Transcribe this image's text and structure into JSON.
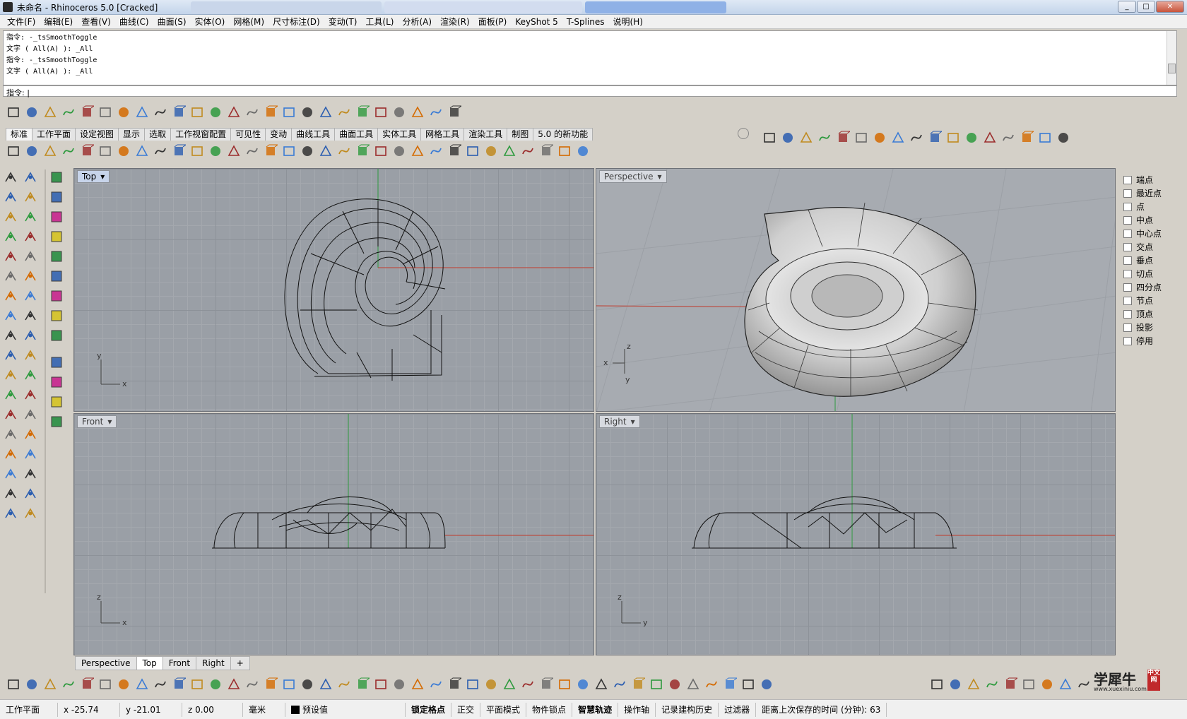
{
  "window": {
    "title": "未命名 - Rhinoceros 5.0 [Cracked]"
  },
  "menu": [
    "文件(F)",
    "编辑(E)",
    "查看(V)",
    "曲线(C)",
    "曲面(S)",
    "实体(O)",
    "网格(M)",
    "尺寸标注(D)",
    "变动(T)",
    "工具(L)",
    "分析(A)",
    "渲染(R)",
    "面板(P)",
    "KeyShot 5",
    "T-Splines",
    "说明(H)"
  ],
  "command_history": [
    "指令: -_tsSmoothToggle",
    "文字 ( All(A) ): _All",
    "指令: -_tsSmoothToggle",
    "文字 ( All(A) ): _All"
  ],
  "command_prompt": "指令:",
  "toolbar_tabs": [
    "标准",
    "工作平面",
    "设定视图",
    "显示",
    "选取",
    "工作视窗配置",
    "可见性",
    "变动",
    "曲线工具",
    "曲面工具",
    "实体工具",
    "网格工具",
    "渲染工具",
    "制图",
    "5.0 的新功能"
  ],
  "viewports": {
    "top": {
      "label": "Top",
      "axis_a": "y",
      "axis_b": "x"
    },
    "perspective": {
      "label": "Perspective",
      "axis_a": "z",
      "axis_b": "x",
      "axis_c": "y"
    },
    "front": {
      "label": "Front",
      "axis_a": "z",
      "axis_b": "x"
    },
    "right": {
      "label": "Right",
      "axis_a": "z",
      "axis_b": "y"
    }
  },
  "osnap": [
    "端点",
    "最近点",
    "点",
    "中点",
    "中心点",
    "交点",
    "垂点",
    "切点",
    "四分点",
    "节点",
    "顶点",
    "投影",
    "停用"
  ],
  "viewport_tabs": [
    "Perspective",
    "Top",
    "Front",
    "Right",
    "+"
  ],
  "status": {
    "cplane": "工作平面",
    "x": "x -25.74",
    "y": "y -21.01",
    "z": "z 0.00",
    "unit": "毫米",
    "layer": "预设值",
    "grid_snap": "锁定格点",
    "ortho": "正交",
    "planar": "平面模式",
    "osnap": "物件锁点",
    "smarttrack": "智慧轨迹",
    "gumball": "操作轴",
    "history": "记录建构历史",
    "filter": "过滤器",
    "autosave": "距离上次保存的时间 (分钟): 63"
  },
  "watermark": {
    "text": "学犀牛",
    "sub": "www.xuexiniu.com",
    "badge": "中文网"
  },
  "colors": {
    "x_axis": "#c0392b",
    "y_axis": "#2e9a3e",
    "viewport_bg": "#9a9fa6",
    "active_label": "#c7d4ea"
  }
}
